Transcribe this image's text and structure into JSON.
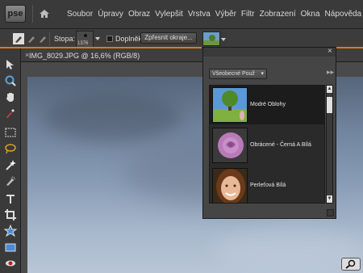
{
  "app": {
    "logo_text": "pse",
    "menu": [
      "Soubor",
      "Úpravy",
      "Obraz",
      "Vylepšit",
      "Vrstva",
      "Výběr",
      "Filtr",
      "Zobrazení",
      "Okna",
      "Nápověda"
    ]
  },
  "options_bar": {
    "brush_label": "Stopa:",
    "brush_size": "1376",
    "addon_label": "Doplněk",
    "refine_button": "Zpřesnit okraje..."
  },
  "document": {
    "tab_title": "IMG_8029.JPG @ 16,6% (RGB/8)"
  },
  "effects_panel": {
    "category": "Všeobecné Použ",
    "items": [
      {
        "label": "Modré Oblohy",
        "selected": true,
        "icon": "tree-sky-thumb"
      },
      {
        "label": "Obrácené - Černá A Bílá",
        "selected": false,
        "icon": "rose-thumb"
      },
      {
        "label": "Perleťová Bílá",
        "selected": false,
        "icon": "portrait-thumb"
      }
    ]
  },
  "colors": {
    "accent_orange": "#e07818",
    "chrome": "#3a3a3a"
  }
}
